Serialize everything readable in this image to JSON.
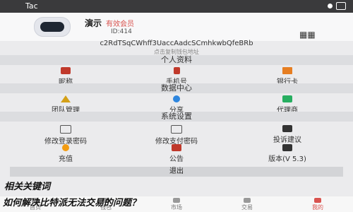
{
  "statusbar": {
    "app_name": "Tac"
  },
  "profile": {
    "name": "演示",
    "level": "有效会员",
    "id": "ID:414",
    "qr_icon": "qr-code-icon"
  },
  "wallet": {
    "address": "c2RdTSqCWhff3UaccAadcSCmhkwbQfeBRb",
    "hint": "点击复制钱包地址"
  },
  "sections": {
    "personal": {
      "title": "个人资料",
      "items": [
        {
          "label": "昵称",
          "icon": "id-card-icon"
        },
        {
          "label": "手机号",
          "icon": "phone-icon"
        },
        {
          "label": "银行卡",
          "icon": "bank-card-icon"
        }
      ]
    },
    "data": {
      "title": "数据中心",
      "items": [
        {
          "label": "团队管理",
          "icon": "team-icon"
        },
        {
          "label": "分享",
          "icon": "share-icon"
        },
        {
          "label": "代理商",
          "icon": "agent-icon"
        }
      ]
    },
    "settings": {
      "title": "系统设置",
      "items": [
        {
          "label": "修改登录密码",
          "icon": "lock-icon"
        },
        {
          "label": "修改支付密码",
          "icon": "key-icon"
        },
        {
          "label": "投诉建议",
          "icon": "feedback-icon"
        },
        {
          "label": "充值",
          "icon": "recharge-icon"
        },
        {
          "label": "公告",
          "icon": "announcement-icon"
        },
        {
          "label": "版本(V 5.3)",
          "icon": "version-icon"
        }
      ]
    }
  },
  "logout_label": "退出",
  "keywords_label": "相关关键词",
  "headline": "如何解决比特派无法交易的问题？",
  "tabs": [
    {
      "label": "首页",
      "icon": "home-icon"
    },
    {
      "label": "钱包",
      "icon": "wallet-icon"
    },
    {
      "label": "市场",
      "icon": "market-icon"
    },
    {
      "label": "交易",
      "icon": "trade-icon"
    },
    {
      "label": "我的",
      "icon": "profile-icon",
      "active": true
    }
  ],
  "colors": {
    "accent": "#d9534f",
    "header": "#3a3a3c",
    "background": "#ebebed"
  }
}
